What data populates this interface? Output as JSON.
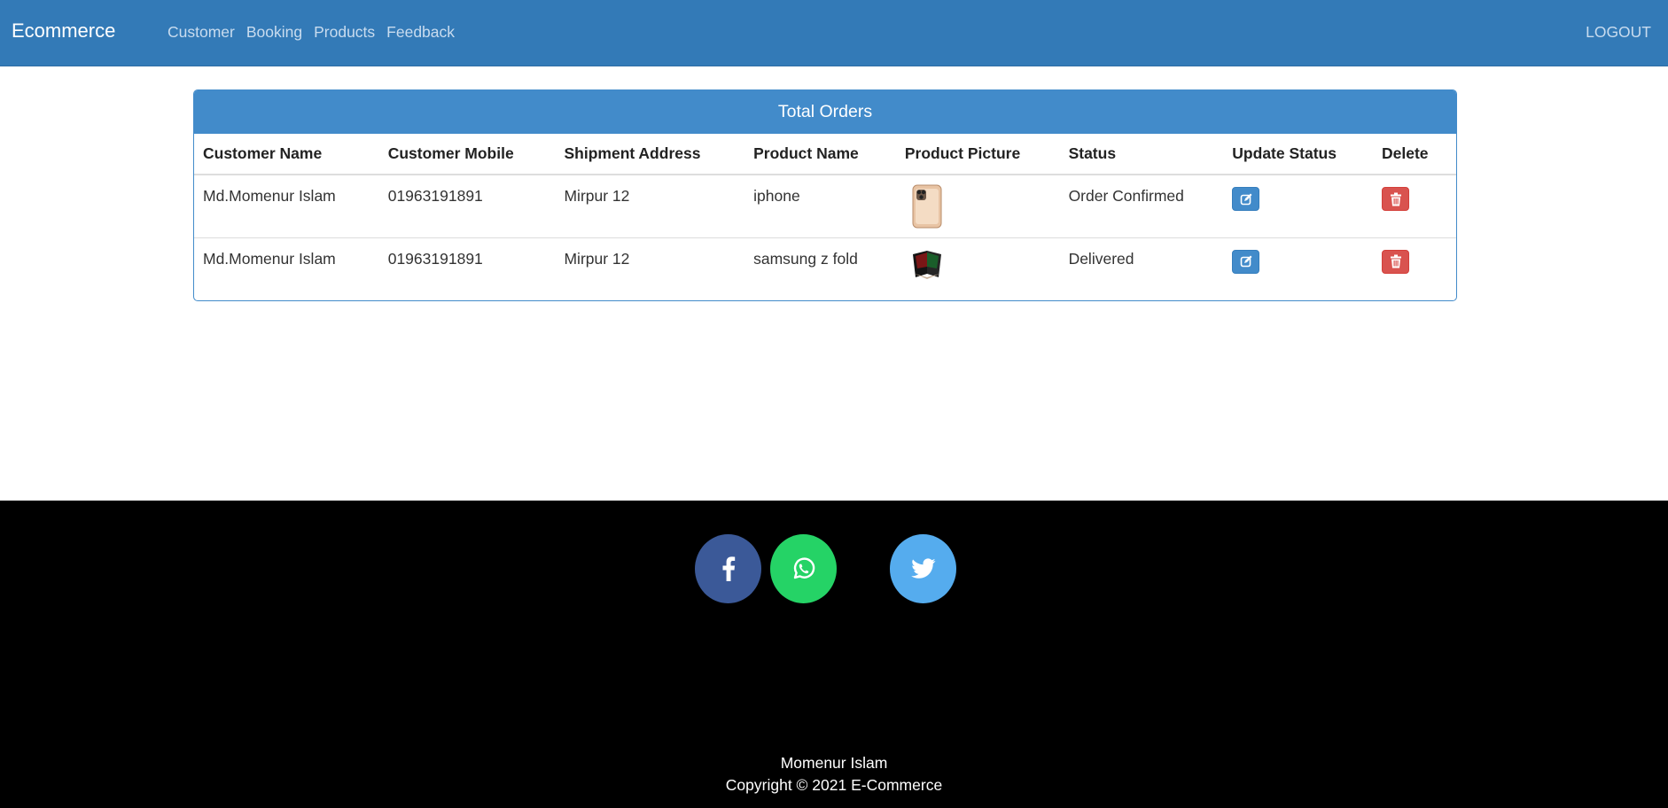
{
  "navbar": {
    "brand": "Ecommerce",
    "links": [
      "Customer",
      "Booking",
      "Products",
      "Feedback"
    ],
    "logout": "LOGOUT"
  },
  "orders": {
    "title": "Total Orders",
    "columns": [
      "Customer Name",
      "Customer Mobile",
      "Shipment Address",
      "Product Name",
      "Product Picture",
      "Status",
      "Update Status",
      "Delete"
    ],
    "rows": [
      {
        "customer_name": "Md.Momenur Islam",
        "mobile": "01963191891",
        "address": "Mirpur 12",
        "product": "iphone",
        "picture": "iphone-thumbnail",
        "status": "Order Confirmed"
      },
      {
        "customer_name": "Md.Momenur Islam",
        "mobile": "01963191891",
        "address": "Mirpur 12",
        "product": "samsung z fold",
        "picture": "samsung-fold-thumbnail",
        "status": "Delivered"
      }
    ]
  },
  "icons": {
    "edit": "edit-icon",
    "delete": "trash-icon",
    "facebook": "facebook-icon",
    "whatsapp": "whatsapp-icon",
    "twitter": "twitter-icon"
  },
  "colors": {
    "navbar": "#337ab7",
    "panel_heading": "#428bca",
    "edit_button": "#428bca",
    "delete_button": "#d9534f",
    "facebook": "#3b5998",
    "whatsapp": "#25d366",
    "twitter": "#55acee",
    "footer": "#000000"
  },
  "footer": {
    "author": "Momenur Islam",
    "copyright": "Copyright © 2021 E-Commerce"
  }
}
